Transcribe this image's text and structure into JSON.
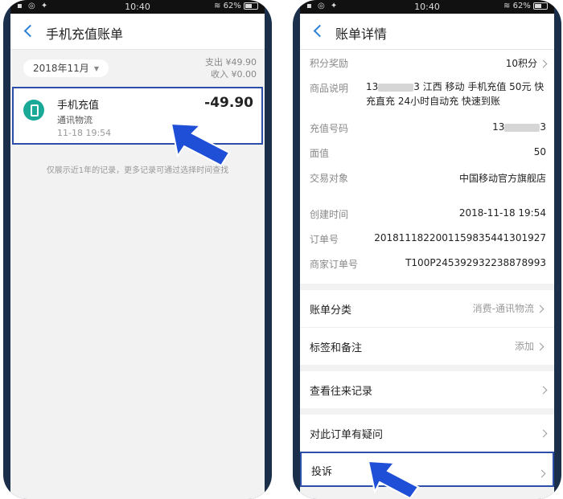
{
  "status": {
    "time": "10:40",
    "battery": "62%"
  },
  "left": {
    "title": "手机充值账单",
    "month": "2018年11月",
    "expense": "支出 ¥49.90",
    "income": "收入 ¥0.00",
    "item": {
      "name": "手机充值",
      "category": "通讯物流",
      "time": "11-18  19:54",
      "amount": "-49.90"
    },
    "hint": "仅展示近1年的记录，更多记录可通过选择时间查找"
  },
  "right": {
    "title": "账单详情",
    "rows": [
      {
        "label": "积分奖励",
        "value": "10积分"
      },
      {
        "label": "商品说明",
        "value_prefix": "13",
        "value_suffix": "3 江西 移动 手机充值 50元 快充直充 24小时自动充 快速到账"
      },
      {
        "label": "充值号码",
        "value_prefix": "13",
        "value_suffix": "3"
      },
      {
        "label": "面值",
        "value": "50"
      },
      {
        "label": "交易对象",
        "value": "中国移动官方旗舰店"
      },
      {
        "label": "创建时间",
        "value": "2018-11-18 19:54"
      },
      {
        "label": "订单号",
        "value": "20181118220011598354413019​27"
      },
      {
        "label": "商家订单号",
        "value": "T100P245392932238878993"
      }
    ],
    "category_label": "账单分类",
    "category_value": "消费-通讯物流",
    "tags_label": "标签和备注",
    "tags_value": "添加",
    "history_label": "查看往来记录",
    "question_label": "对此订单有疑问",
    "complain_label": "投诉"
  },
  "colors": {
    "accent": "#2a7fd4",
    "highlight": "#2b4fa8",
    "arrow": "#1f4fd6",
    "icon": "#1aa897"
  }
}
